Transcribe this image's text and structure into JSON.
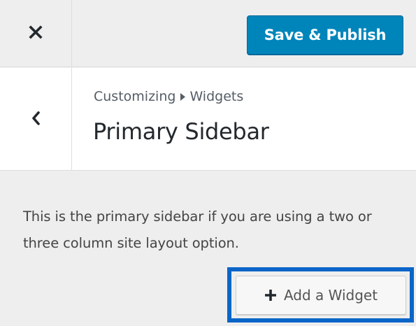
{
  "header": {
    "close_icon": "close-icon",
    "save_label": "Save & Publish",
    "accent_color": "#0085ba"
  },
  "section": {
    "back_icon": "chevron-left-icon",
    "breadcrumb": {
      "parent": "Customizing",
      "separator_icon": "arrow-right-icon",
      "current": "Widgets"
    },
    "title": "Primary Sidebar"
  },
  "description": "This is the primary sidebar if you are using a two or three column site layout option.",
  "add_widget": {
    "icon": "plus-icon",
    "label": "Add a Widget",
    "highlight_color": "#0b65c8"
  }
}
